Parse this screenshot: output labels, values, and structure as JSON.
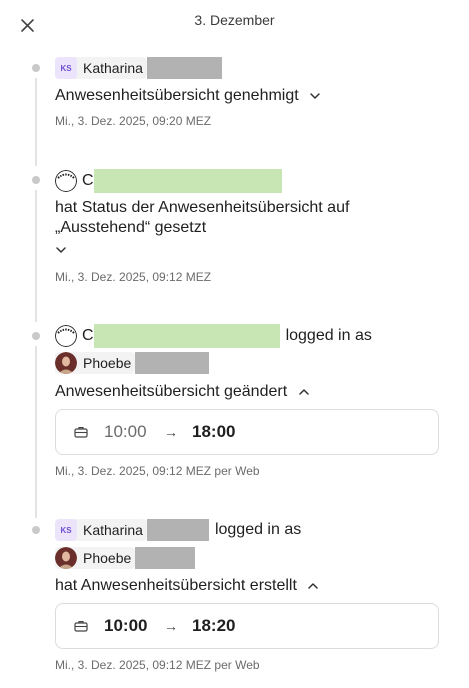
{
  "header": {
    "title": "3. Dezember"
  },
  "events": [
    {
      "user_initials": "KS",
      "user_name": "Katharina",
      "action": "Anwesenheitsübersicht genehmigt",
      "timestamp": "Mi., 3. Dez. 2025, 09:20 MEZ"
    },
    {
      "user_initials": "C",
      "action_line1": "hat Status der Anwesenheitsübersicht auf",
      "action_line2": "„Ausstehend“ gesetzt",
      "timestamp": "Mi., 3. Dez. 2025, 09:12 MEZ"
    },
    {
      "user_initials": "C",
      "logged_in_as": "logged in as",
      "target_name": "Phoebe",
      "action": "Anwesenheitsübersicht geändert",
      "time_from": "10:00",
      "time_to": "18:00",
      "timestamp": "Mi., 3. Dez. 2025, 09:12 MEZ per Web"
    },
    {
      "user_initials": "KS",
      "user_name": "Katharina",
      "logged_in_as": "logged in as",
      "target_name": "Phoebe",
      "action": "hat Anwesenheitsübersicht erstellt",
      "time_from": "10:00",
      "time_to": "18:20",
      "timestamp": "Mi., 3. Dez. 2025, 09:12 MEZ per Web"
    }
  ],
  "icons": {
    "close": "close-icon",
    "chevron_down": "chevron-down-icon",
    "chevron_up": "chevron-up-icon",
    "arrow_right": "arrow-right-icon",
    "briefcase": "briefcase-icon"
  },
  "colors": {
    "avatar_ks_bg": "#ece4fb",
    "avatar_ks_text": "#6e4fcf",
    "redaction_gray": "#b2b2b2",
    "redaction_green": "#c8e6b4"
  }
}
